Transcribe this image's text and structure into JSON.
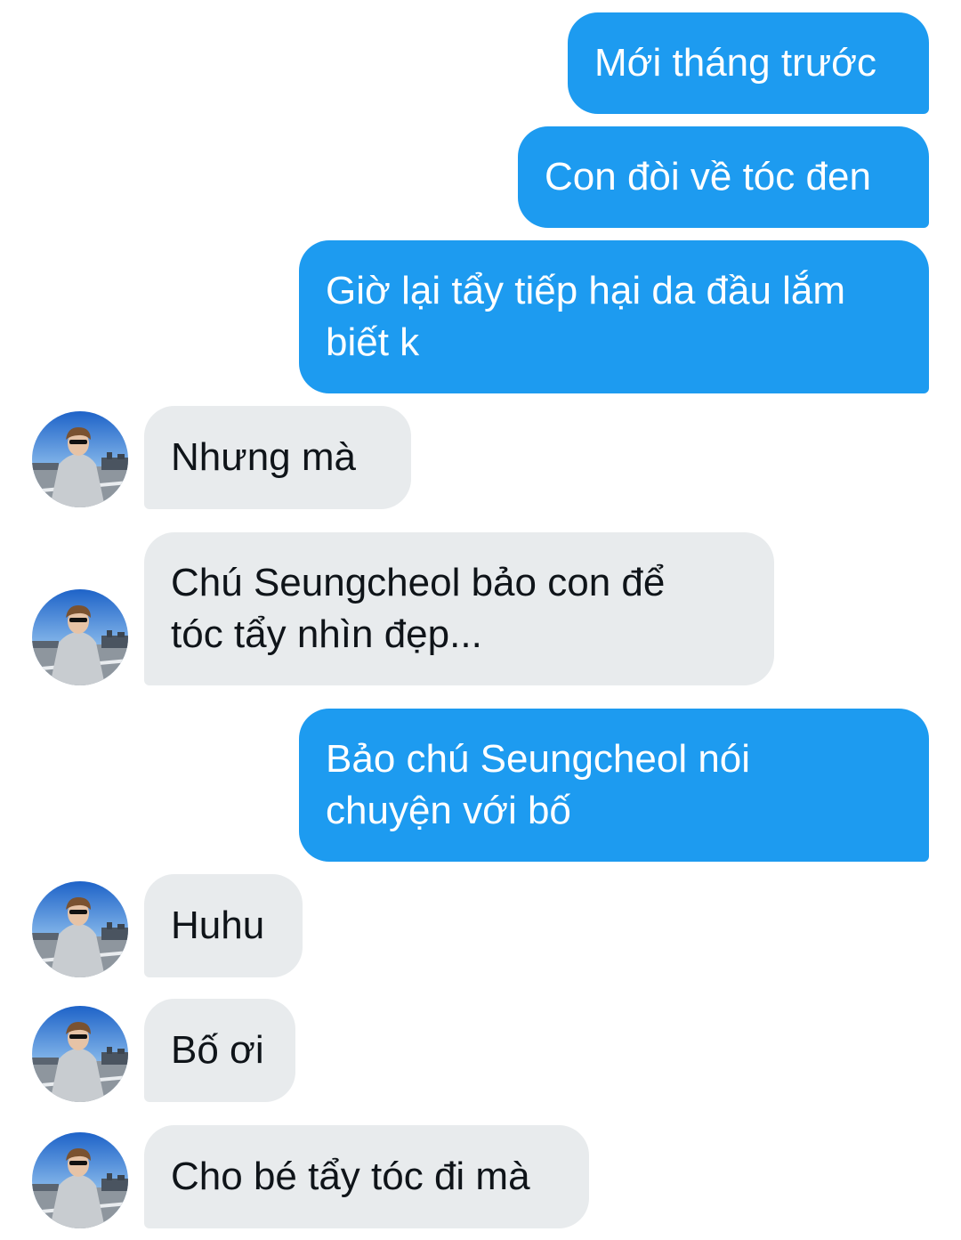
{
  "conversation": {
    "messages": [
      {
        "id": "m1",
        "direction": "outgoing",
        "text": "Mới tháng trước"
      },
      {
        "id": "m2",
        "direction": "outgoing",
        "text": "Con đòi về tóc đen"
      },
      {
        "id": "m3",
        "direction": "outgoing",
        "text": "Giờ lại tẩy tiếp hại da đầu lắm\nbiết k"
      },
      {
        "id": "m4",
        "direction": "incoming",
        "text": "Nhưng mà"
      },
      {
        "id": "m5",
        "direction": "incoming",
        "text": "Chú Seungcheol bảo con để\ntóc tẩy nhìn đẹp..."
      },
      {
        "id": "m6",
        "direction": "outgoing",
        "text": "Bảo chú Seungcheol nói\nchuyện với bố"
      },
      {
        "id": "m7",
        "direction": "incoming",
        "text": "Huhu"
      },
      {
        "id": "m8",
        "direction": "incoming",
        "text": "Bố ơi"
      },
      {
        "id": "m9",
        "direction": "incoming",
        "text": "Cho bé tẩy tóc đi mà"
      }
    ]
  },
  "colors": {
    "outgoing_bubble": "#1d9bf0",
    "outgoing_text": "#ffffff",
    "incoming_bubble": "#e8ebed",
    "incoming_text": "#0f1419",
    "background": "#ffffff"
  },
  "icons": {
    "avatar": "contact-avatar-photo"
  }
}
